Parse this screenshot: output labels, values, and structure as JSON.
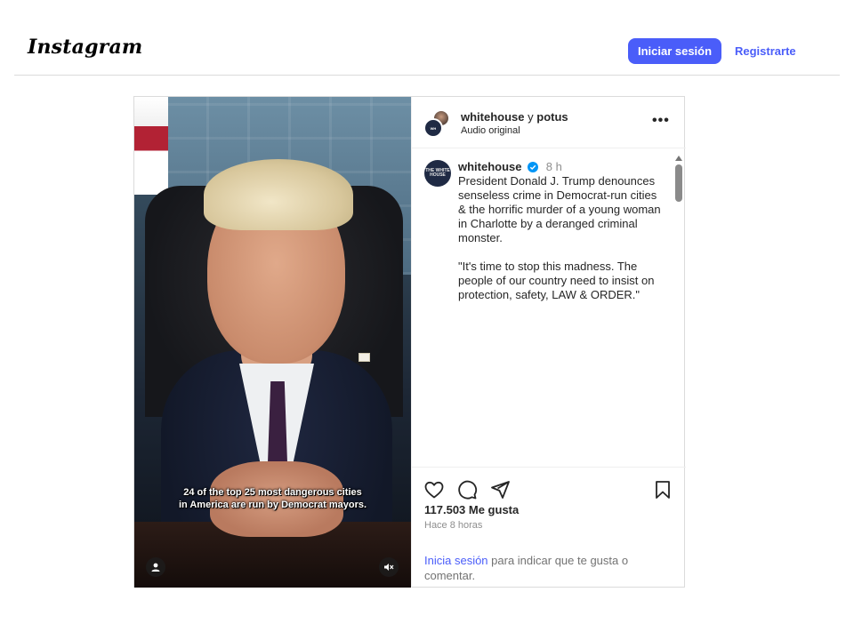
{
  "header": {
    "logo": "Instagram",
    "login_button": "Iniciar sesión",
    "signup_link": "Registrarte"
  },
  "media": {
    "caption_lines": [
      "24 of the top 25 most dangerous cities",
      "in America are run by Democrat mayors."
    ],
    "icons": [
      "user-icon",
      "mute-icon"
    ]
  },
  "post_header": {
    "user1": "whitehouse",
    "connector": "y",
    "user2": "potus",
    "audio": "Audio original",
    "more": "•••"
  },
  "comment": {
    "username": "whitehouse",
    "time": "8 h",
    "avatar_text": "THE WHITE HOUSE",
    "paragraph1": "President Donald J. Trump denounces senseless crime in Democrat-run cities & the horrific murder of a young woman in Charlotte by a deranged criminal monster.",
    "paragraph2": "\"It's time to stop this madness. The people of our country need to insist on protection, safety, LAW & ORDER.\"",
    "verified_color": "#0095f6"
  },
  "actions": {
    "likes": "117.503 Me gusta",
    "time_ago": "Hace 8 horas",
    "login_link": "Inicia sesión",
    "login_text": " para indicar que te gusta o comentar."
  },
  "colors": {
    "accent": "#4a5df9",
    "border": "#dbdbdb",
    "muted": "#8e8e8e"
  }
}
